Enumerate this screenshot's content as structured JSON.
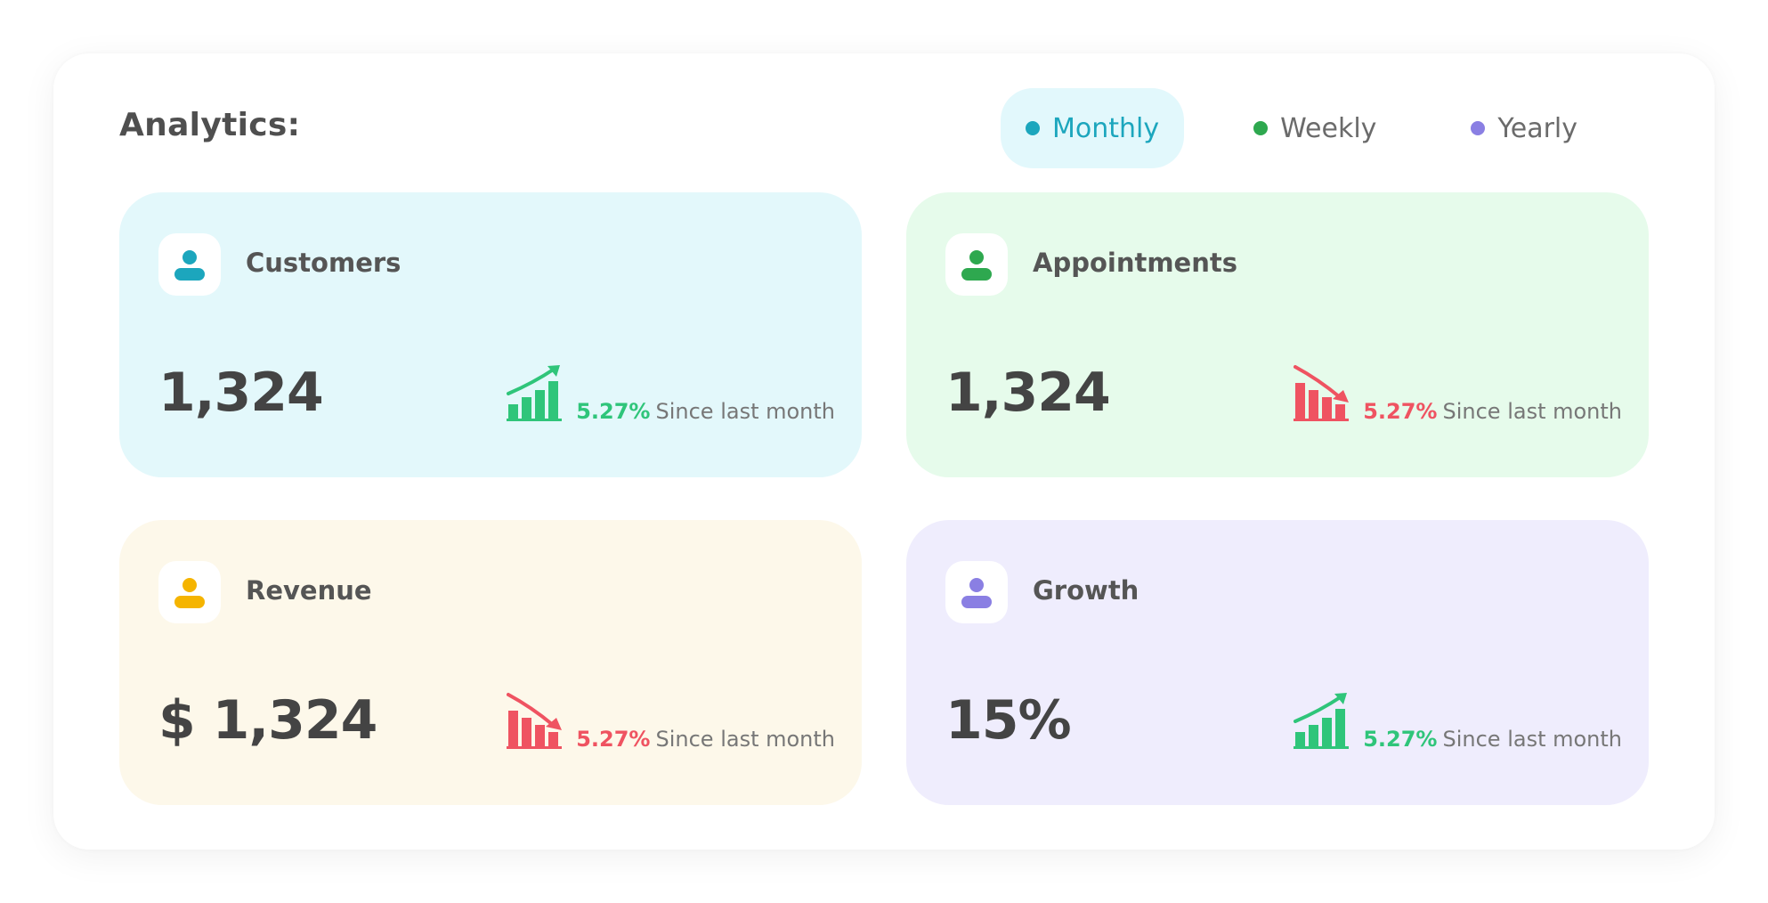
{
  "header": {
    "title": "Analytics:"
  },
  "filters": [
    {
      "label": "Monthly",
      "dot_color": "#1ca6bd",
      "text_color": "#1ca6bd",
      "active": true
    },
    {
      "label": "Weekly",
      "dot_color": "#2ea84f",
      "text_color": "#6b6b6b",
      "active": false
    },
    {
      "label": "Yearly",
      "dot_color": "#8a7fe3",
      "text_color": "#6b6b6b",
      "active": false
    }
  ],
  "cards": [
    {
      "label": "Customers",
      "value": "1,324",
      "background": "#e3f8fb",
      "icon": "user-icon",
      "icon_color": "#1ca6bd",
      "trend": "up",
      "change": "5.27%",
      "since": "Since last month"
    },
    {
      "label": "Appointments",
      "value": "1,324",
      "background": "#e6fbeb",
      "icon": "user-icon",
      "icon_color": "#2ea84f",
      "trend": "down",
      "change": "5.27%",
      "since": "Since last month"
    },
    {
      "label": "Revenue",
      "value": "$ 1,324",
      "background": "#fdf8ea",
      "icon": "user-icon",
      "icon_color": "#f5b400",
      "trend": "down",
      "change": "5.27%",
      "since": "Since last month"
    },
    {
      "label": "Growth",
      "value": "15%",
      "background": "#efedfd",
      "icon": "user-icon",
      "icon_color": "#8a7fe3",
      "trend": "up",
      "change": "5.27%",
      "since": "Since last month"
    }
  ],
  "colors": {
    "trend_up": "#2fc57a",
    "trend_down": "#ef5361"
  }
}
